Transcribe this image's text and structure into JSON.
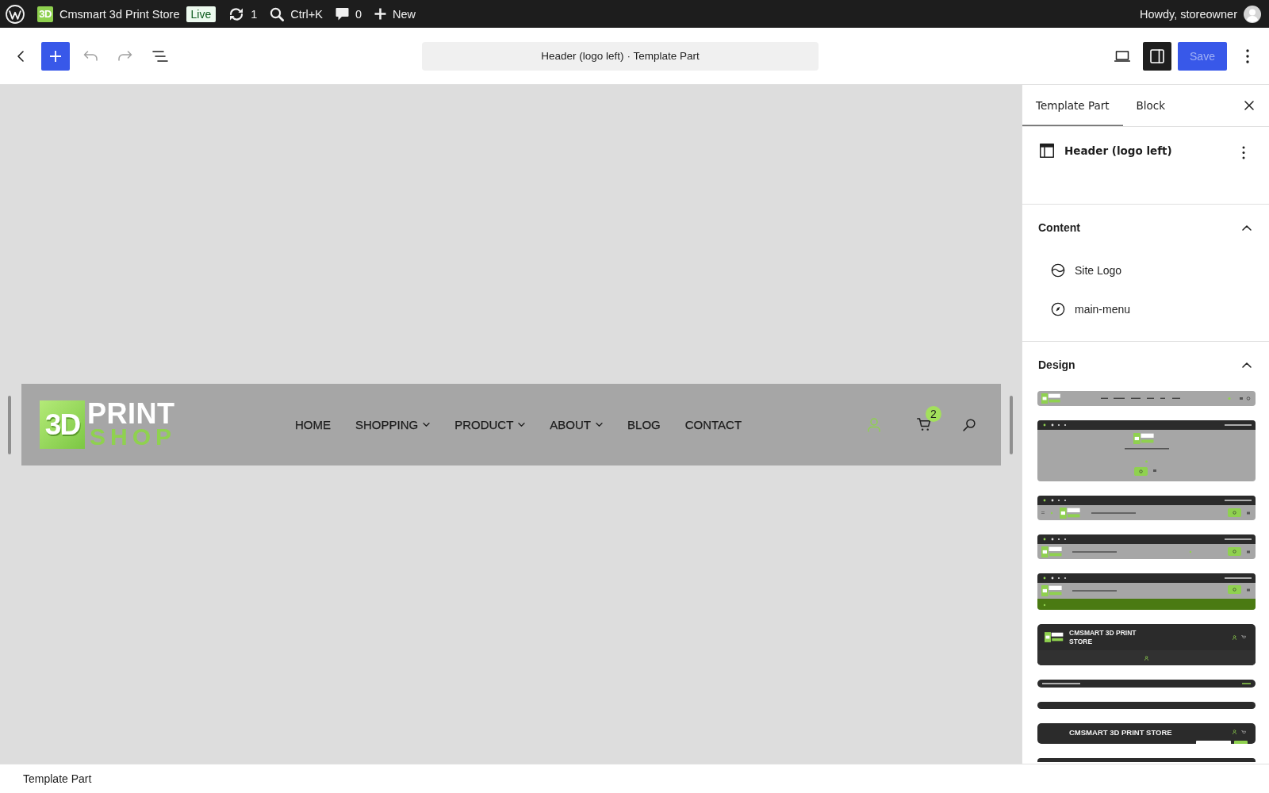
{
  "admin_bar": {
    "site_icon": "3D",
    "site_name": "Cmsmart 3d Print Store",
    "status_badge": "Live",
    "updates": "1",
    "search_shortcut": "Ctrl+K",
    "comments": "0",
    "new": "New",
    "greeting": "Howdy, storeowner"
  },
  "toolbar": {
    "undo": {
      "disabled": true
    },
    "redo": {
      "disabled": true
    },
    "document": {
      "title": "Header (logo left)",
      "type": "· Template Part"
    },
    "settings_toggle": {
      "pressed": true
    },
    "save": {
      "label": "Save",
      "disabled": true
    }
  },
  "canvas": {
    "header": {
      "logo": {
        "mark": "3D",
        "top": "PRINT",
        "bottom": "SHOP"
      },
      "menu": [
        {
          "label": "HOME",
          "has_submenu": false
        },
        {
          "label": "SHOPPING",
          "has_submenu": true
        },
        {
          "label": "PRODUCT",
          "has_submenu": true
        },
        {
          "label": "ABOUT",
          "has_submenu": true
        },
        {
          "label": "BLOG",
          "has_submenu": false
        },
        {
          "label": "CONTACT",
          "has_submenu": false
        }
      ],
      "cart_count": "2"
    }
  },
  "sidebar": {
    "tabs": [
      {
        "label": "Template Part",
        "selected": true
      },
      {
        "label": "Block",
        "selected": false
      }
    ],
    "card": {
      "title": "Header (logo left)"
    },
    "panels": [
      {
        "title": "Content",
        "expanded": true,
        "items": [
          {
            "label": "Site Logo",
            "kind": "logo"
          },
          {
            "label": "main-menu",
            "kind": "navigation"
          }
        ]
      },
      {
        "title": "Design",
        "expanded": true,
        "patterns": [
          {
            "kind": "inline-menu"
          },
          {
            "kind": "centered-logo"
          },
          {
            "kind": "topbar-menu-logo"
          },
          {
            "kind": "topbar-logo"
          },
          {
            "kind": "topbar-green"
          },
          {
            "kind": "dark-stacked",
            "title": "CMSMART 3D PRINT STORE"
          },
          {
            "kind": "dark-strip"
          },
          {
            "kind": "dark-bar"
          },
          {
            "kind": "dark-title",
            "title": "CMSMART 3D PRINT STORE"
          },
          {
            "kind": "dark-edge"
          }
        ]
      }
    ]
  },
  "status_bar": {
    "breadcrumb": "Template Part"
  }
}
